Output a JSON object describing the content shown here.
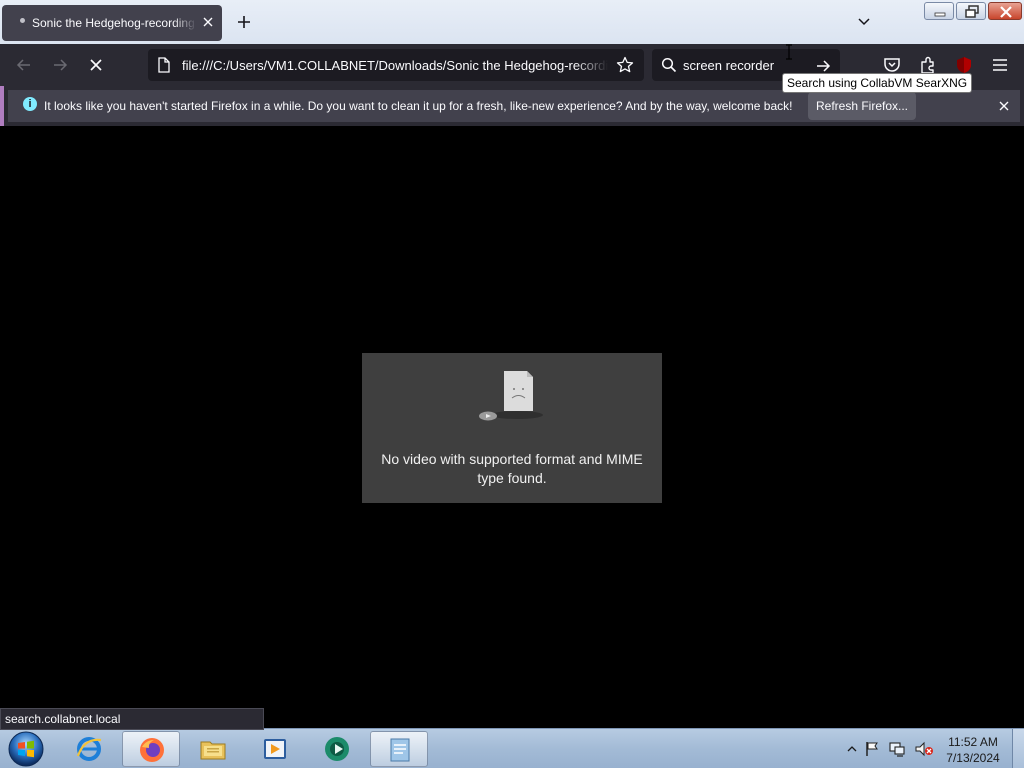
{
  "browser": {
    "tab": {
      "title": "Sonic the Hedgehog-recording",
      "close_icon": "close-icon"
    },
    "new_tab_icon": "plus-icon",
    "list_all_tabs_icon": "chevron-down-icon",
    "window_controls": [
      "minimize",
      "restore",
      "close"
    ],
    "nav": {
      "back_icon": "arrow-left-icon",
      "forward_icon": "arrow-right-icon",
      "stop_icon": "close-icon"
    },
    "urlbar": {
      "value": "file:///C:/Users/VM1.COLLABNET/Downloads/Sonic the Hedgehog-recording",
      "page_icon": "document-icon",
      "bookmark_icon": "star-icon"
    },
    "searchbar": {
      "value": "screen recorder",
      "search_icon": "search-icon",
      "go_icon": "arrow-right-icon"
    },
    "tooltip": "Search using CollabVM SearXNG",
    "toolbar_icons": [
      "pocket-icon",
      "extensions-icon",
      "ublock-icon",
      "menu-icon"
    ],
    "notification": {
      "message": "It looks like you haven't started Firefox in a while. Do you want to clean it up for a fresh, like-new experience? And by the way, welcome back!",
      "button": "Refresh Firefox...",
      "info_icon": "i"
    },
    "video_error": {
      "message": "No video with supported format and MIME type found."
    },
    "status": "search.collabnet.local"
  },
  "taskbar": {
    "items": [
      "internet-explorer-icon",
      "firefox-icon",
      "file-explorer-icon",
      "media-player-icon",
      "recorder-app-icon",
      "notepad-app-icon"
    ],
    "tray": [
      "show-hidden-icons",
      "action-center-flag-icon",
      "network-icon",
      "volume-muted-icon"
    ],
    "clock": {
      "time": "11:52 AM",
      "date": "7/13/2024"
    }
  }
}
